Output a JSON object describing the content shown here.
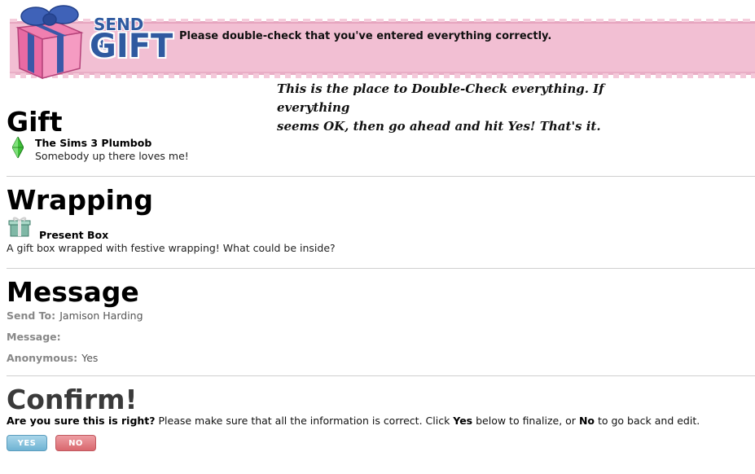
{
  "header": {
    "logo_line1": "SEND A",
    "logo_line2": "GIFT",
    "banner_message": "Please double-check that you've entered everything correctly."
  },
  "note": {
    "line1": "This is the place to Double-Check everything. If everything",
    "line2": "seems OK, then go ahead and hit Yes! That's it."
  },
  "gift": {
    "title": "Gift",
    "item_name": "The Sims 3 Plumbob",
    "item_desc": "Somebody up there loves me!",
    "icon": "plumbob-icon"
  },
  "wrapping": {
    "title": "Wrapping",
    "item_name": "Present Box",
    "item_desc": "A gift box wrapped with festive wrapping! What could be inside?",
    "icon": "present-box-icon"
  },
  "message": {
    "title": "Message",
    "send_to_label": "Send To:",
    "send_to_value": "Jamison Harding",
    "message_label": "Message:",
    "message_value": "",
    "anonymous_label": "Anonymous:",
    "anonymous_value": "Yes"
  },
  "confirm": {
    "title": "Confirm!",
    "question": "Are you sure this is right?",
    "text_a": " Please make sure that all the information is correct. Click ",
    "yes_word": "Yes",
    "text_b": " below to finalize, or ",
    "no_word": "No",
    "text_c": " to go back and edit.",
    "yes_button": "YES",
    "no_button": "NO"
  },
  "colors": {
    "banner_pink": "#f2bfd3",
    "logo_blue": "#2f5aa0",
    "yes_blue": "#6fb3d3",
    "no_red": "#d9676e"
  }
}
